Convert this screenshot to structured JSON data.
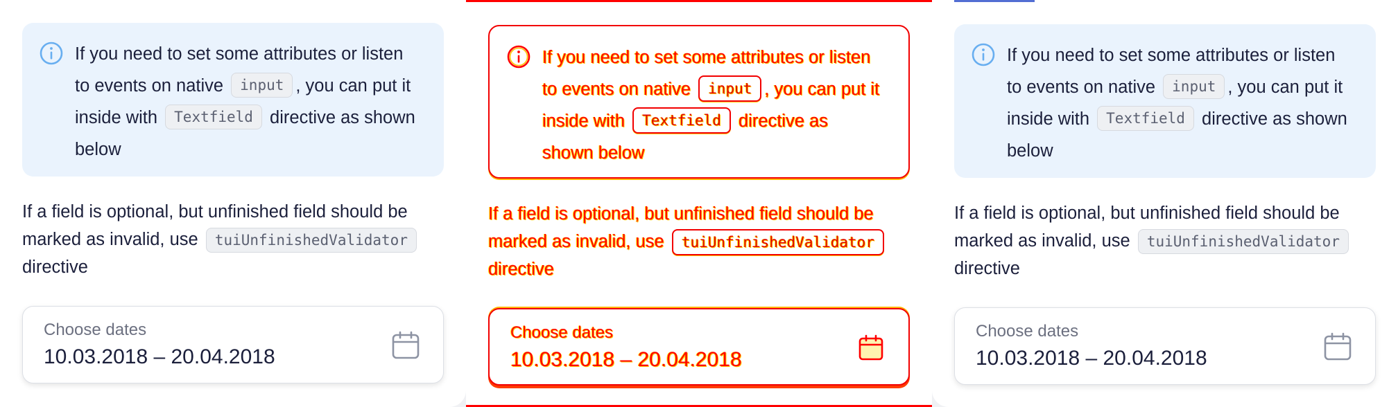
{
  "panels": [
    {
      "notice": {
        "text_before": "If you need to set some attributes or listen to events on native",
        "code1": "input",
        "text_mid": ", you can put it inside with",
        "code2": "Textfield",
        "text_after": "directive as shown below",
        "icon": "info-icon"
      },
      "paragraph": {
        "text": "If a field is optional, but unfinished field should be marked as invalid, use",
        "code": "tuiUnfinishedValidator",
        "text_after": "directive"
      },
      "date_field": {
        "label": "Choose dates",
        "value": "10.03.2018 – 20.04.2018",
        "icon": "calendar-icon"
      }
    },
    {
      "notice": {
        "text_before": "If you need to set some attributes or listen to events on native",
        "code1": "input",
        "text_mid": ", you can put it inside with",
        "code2": "Textfield",
        "text_after": "directive as shown below",
        "icon": "info-icon"
      },
      "paragraph": {
        "text": "If a field is optional, but unfinished field should be marked as invalid, use",
        "code": "tuiUnfinishedValidator",
        "text_after": "directive"
      },
      "date_field": {
        "label": "Choose dates",
        "value": "10.03.2018 – 20.04.2018",
        "icon": "calendar-icon"
      }
    },
    {
      "notice": {
        "text_before": "If you need to set some attributes or listen to events on native",
        "code1": "input",
        "text_mid": ", you can put it inside with",
        "code2": "Textfield",
        "text_after": "directive as shown below",
        "icon": "info-icon"
      },
      "paragraph": {
        "text": "If a field is optional, but unfinished field should be marked as invalid, use",
        "code": "tuiUnfinishedValidator",
        "text_after": "directive"
      },
      "date_field": {
        "label": "Choose dates",
        "value": "10.03.2018 – 20.04.2018",
        "icon": "calendar-icon"
      }
    }
  ],
  "colors": {
    "diff_primary": "#ff0000",
    "diff_secondary": "#ffc400",
    "info_accent": "#68aef0",
    "notice_bg": "#eaf3fd"
  }
}
